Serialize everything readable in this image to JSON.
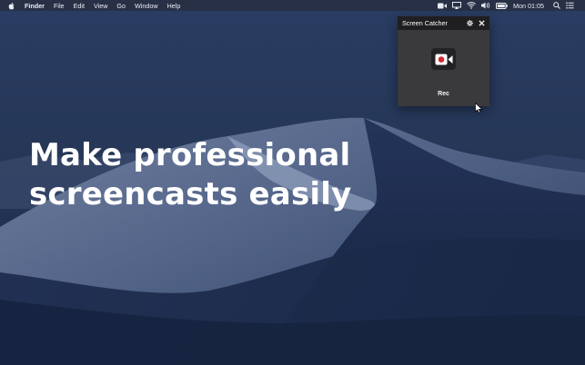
{
  "menubar": {
    "apple": "apple-icon",
    "items": [
      {
        "label": "Finder",
        "bold": true
      },
      {
        "label": "File"
      },
      {
        "label": "Edit"
      },
      {
        "label": "View"
      },
      {
        "label": "Go"
      },
      {
        "label": "Window"
      },
      {
        "label": "Help"
      }
    ],
    "status_icons": [
      "video-camera-icon",
      "airplay-icon",
      "wifi-icon",
      "volume-icon",
      "battery-icon"
    ],
    "clock": "Mon 01:05",
    "right_icons": [
      "search-icon",
      "list-icon"
    ]
  },
  "headline": {
    "line1": "Make professional",
    "line2": "screencasts easily"
  },
  "panel": {
    "title": "Screen Catcher",
    "settings_icon": "gear-icon",
    "close_icon": "close-icon",
    "rec_icon": "record-camera-icon",
    "rec_label": "Rec"
  },
  "colors": {
    "panel_bg": "#3a3a3c",
    "panel_header": "#1f1f21",
    "record_red": "#d9262c",
    "desktop_sky": "#1b2a4a"
  }
}
